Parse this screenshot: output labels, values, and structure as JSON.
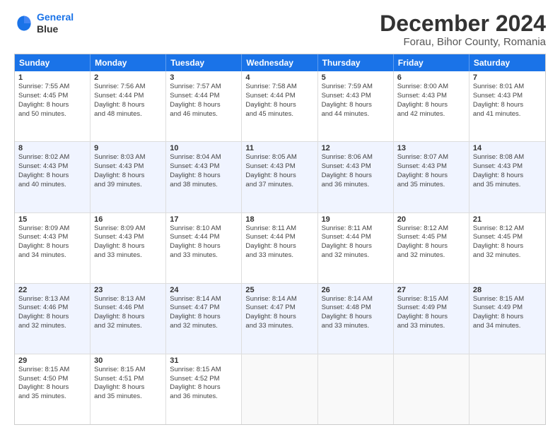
{
  "header": {
    "logo_line1": "General",
    "logo_line2": "Blue",
    "title": "December 2024",
    "subtitle": "Forau, Bihor County, Romania"
  },
  "days_of_week": [
    "Sunday",
    "Monday",
    "Tuesday",
    "Wednesday",
    "Thursday",
    "Friday",
    "Saturday"
  ],
  "rows": [
    [
      {
        "day": "1",
        "lines": [
          "Sunrise: 7:55 AM",
          "Sunset: 4:45 PM",
          "Daylight: 8 hours",
          "and 50 minutes."
        ]
      },
      {
        "day": "2",
        "lines": [
          "Sunrise: 7:56 AM",
          "Sunset: 4:44 PM",
          "Daylight: 8 hours",
          "and 48 minutes."
        ]
      },
      {
        "day": "3",
        "lines": [
          "Sunrise: 7:57 AM",
          "Sunset: 4:44 PM",
          "Daylight: 8 hours",
          "and 46 minutes."
        ]
      },
      {
        "day": "4",
        "lines": [
          "Sunrise: 7:58 AM",
          "Sunset: 4:44 PM",
          "Daylight: 8 hours",
          "and 45 minutes."
        ]
      },
      {
        "day": "5",
        "lines": [
          "Sunrise: 7:59 AM",
          "Sunset: 4:43 PM",
          "Daylight: 8 hours",
          "and 44 minutes."
        ]
      },
      {
        "day": "6",
        "lines": [
          "Sunrise: 8:00 AM",
          "Sunset: 4:43 PM",
          "Daylight: 8 hours",
          "and 42 minutes."
        ]
      },
      {
        "day": "7",
        "lines": [
          "Sunrise: 8:01 AM",
          "Sunset: 4:43 PM",
          "Daylight: 8 hours",
          "and 41 minutes."
        ]
      }
    ],
    [
      {
        "day": "8",
        "lines": [
          "Sunrise: 8:02 AM",
          "Sunset: 4:43 PM",
          "Daylight: 8 hours",
          "and 40 minutes."
        ]
      },
      {
        "day": "9",
        "lines": [
          "Sunrise: 8:03 AM",
          "Sunset: 4:43 PM",
          "Daylight: 8 hours",
          "and 39 minutes."
        ]
      },
      {
        "day": "10",
        "lines": [
          "Sunrise: 8:04 AM",
          "Sunset: 4:43 PM",
          "Daylight: 8 hours",
          "and 38 minutes."
        ]
      },
      {
        "day": "11",
        "lines": [
          "Sunrise: 8:05 AM",
          "Sunset: 4:43 PM",
          "Daylight: 8 hours",
          "and 37 minutes."
        ]
      },
      {
        "day": "12",
        "lines": [
          "Sunrise: 8:06 AM",
          "Sunset: 4:43 PM",
          "Daylight: 8 hours",
          "and 36 minutes."
        ]
      },
      {
        "day": "13",
        "lines": [
          "Sunrise: 8:07 AM",
          "Sunset: 4:43 PM",
          "Daylight: 8 hours",
          "and 35 minutes."
        ]
      },
      {
        "day": "14",
        "lines": [
          "Sunrise: 8:08 AM",
          "Sunset: 4:43 PM",
          "Daylight: 8 hours",
          "and 35 minutes."
        ]
      }
    ],
    [
      {
        "day": "15",
        "lines": [
          "Sunrise: 8:09 AM",
          "Sunset: 4:43 PM",
          "Daylight: 8 hours",
          "and 34 minutes."
        ]
      },
      {
        "day": "16",
        "lines": [
          "Sunrise: 8:09 AM",
          "Sunset: 4:43 PM",
          "Daylight: 8 hours",
          "and 33 minutes."
        ]
      },
      {
        "day": "17",
        "lines": [
          "Sunrise: 8:10 AM",
          "Sunset: 4:44 PM",
          "Daylight: 8 hours",
          "and 33 minutes."
        ]
      },
      {
        "day": "18",
        "lines": [
          "Sunrise: 8:11 AM",
          "Sunset: 4:44 PM",
          "Daylight: 8 hours",
          "and 33 minutes."
        ]
      },
      {
        "day": "19",
        "lines": [
          "Sunrise: 8:11 AM",
          "Sunset: 4:44 PM",
          "Daylight: 8 hours",
          "and 32 minutes."
        ]
      },
      {
        "day": "20",
        "lines": [
          "Sunrise: 8:12 AM",
          "Sunset: 4:45 PM",
          "Daylight: 8 hours",
          "and 32 minutes."
        ]
      },
      {
        "day": "21",
        "lines": [
          "Sunrise: 8:12 AM",
          "Sunset: 4:45 PM",
          "Daylight: 8 hours",
          "and 32 minutes."
        ]
      }
    ],
    [
      {
        "day": "22",
        "lines": [
          "Sunrise: 8:13 AM",
          "Sunset: 4:46 PM",
          "Daylight: 8 hours",
          "and 32 minutes."
        ]
      },
      {
        "day": "23",
        "lines": [
          "Sunrise: 8:13 AM",
          "Sunset: 4:46 PM",
          "Daylight: 8 hours",
          "and 32 minutes."
        ]
      },
      {
        "day": "24",
        "lines": [
          "Sunrise: 8:14 AM",
          "Sunset: 4:47 PM",
          "Daylight: 8 hours",
          "and 32 minutes."
        ]
      },
      {
        "day": "25",
        "lines": [
          "Sunrise: 8:14 AM",
          "Sunset: 4:47 PM",
          "Daylight: 8 hours",
          "and 33 minutes."
        ]
      },
      {
        "day": "26",
        "lines": [
          "Sunrise: 8:14 AM",
          "Sunset: 4:48 PM",
          "Daylight: 8 hours",
          "and 33 minutes."
        ]
      },
      {
        "day": "27",
        "lines": [
          "Sunrise: 8:15 AM",
          "Sunset: 4:49 PM",
          "Daylight: 8 hours",
          "and 33 minutes."
        ]
      },
      {
        "day": "28",
        "lines": [
          "Sunrise: 8:15 AM",
          "Sunset: 4:49 PM",
          "Daylight: 8 hours",
          "and 34 minutes."
        ]
      }
    ],
    [
      {
        "day": "29",
        "lines": [
          "Sunrise: 8:15 AM",
          "Sunset: 4:50 PM",
          "Daylight: 8 hours",
          "and 35 minutes."
        ]
      },
      {
        "day": "30",
        "lines": [
          "Sunrise: 8:15 AM",
          "Sunset: 4:51 PM",
          "Daylight: 8 hours",
          "and 35 minutes."
        ]
      },
      {
        "day": "31",
        "lines": [
          "Sunrise: 8:15 AM",
          "Sunset: 4:52 PM",
          "Daylight: 8 hours",
          "and 36 minutes."
        ]
      },
      {
        "day": "",
        "lines": []
      },
      {
        "day": "",
        "lines": []
      },
      {
        "day": "",
        "lines": []
      },
      {
        "day": "",
        "lines": []
      }
    ]
  ]
}
